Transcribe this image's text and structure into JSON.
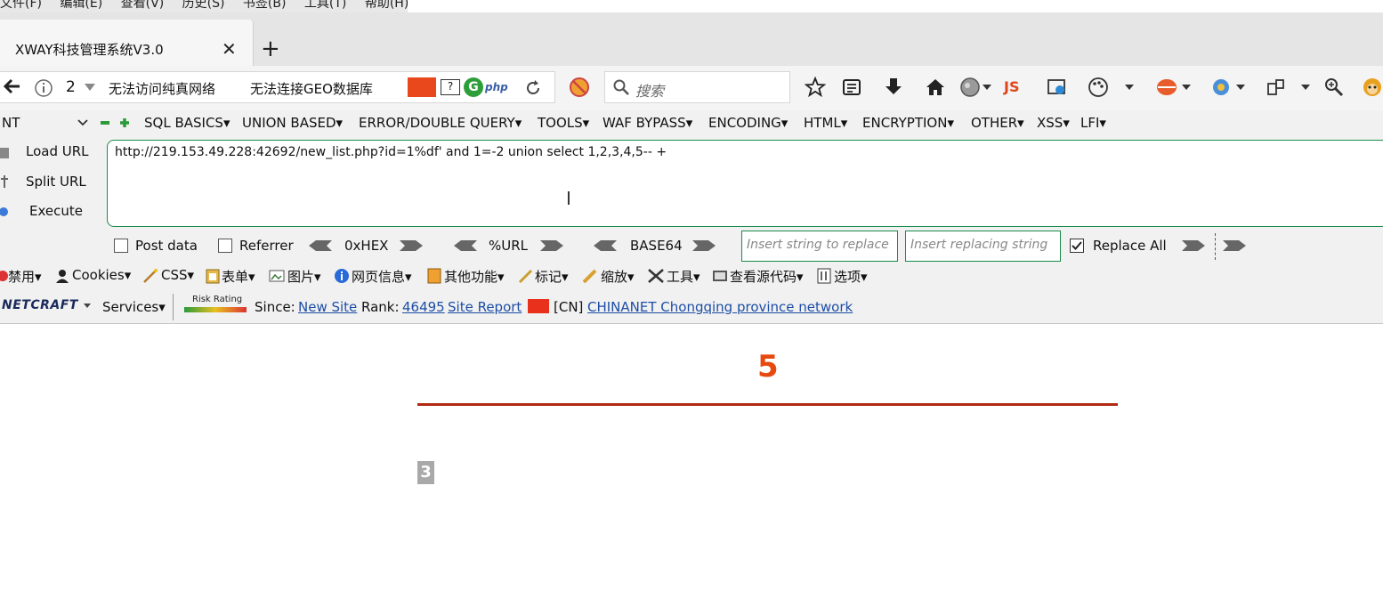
{
  "menubar": [
    "文件(F)",
    "编辑(E)",
    "查看(V)",
    "历史(S)",
    "书签(B)",
    "工具(T)",
    "帮助(H)"
  ],
  "tab": {
    "title": "XWAY科技管理系统V3.0",
    "close": "✕",
    "new": "+"
  },
  "nav": {
    "count": "2",
    "proxy1": "无法访问纯真网络",
    "proxy2": "无法连接GEO数据库",
    "search_placeholder": "搜索",
    "js": "JS"
  },
  "hackbar": {
    "select": "NT",
    "menus": [
      "SQL BASICS▾",
      "UNION BASED▾",
      "ERROR/DOUBLE QUERY▾",
      "TOOLS▾",
      "WAF BYPASS▾",
      "ENCODING▾",
      "HTML▾",
      "ENCRYPTION▾",
      "OTHER▾",
      "XSS▾",
      "LFI▾"
    ],
    "load_url": "Load URL",
    "split_url": "Split URL",
    "execute": "Execute",
    "url": "http://219.153.49.228:42692/new_list.php?id=1%df' and 1=-2 union select 1,2,3,4,5-- +",
    "post_data": "Post data",
    "referrer": "Referrer",
    "hex": "0xHEX",
    "urlenc": "%URL",
    "base64": "BASE64",
    "insert_placeholder": "Insert string to replace",
    "replacing_placeholder": "Insert replacing string",
    "replace_all": "Replace All"
  },
  "webdev": [
    "禁用▾",
    "Cookies▾",
    "CSS▾",
    "表单▾",
    "图片▾",
    "网页信息▾",
    "其他功能▾",
    "标记▾",
    "缩放▾",
    "工具▾",
    "查看源代码▾",
    "选项▾"
  ],
  "netcraft": {
    "logo": "NETCRAFT",
    "services": "Services▾",
    "risk": "Risk Rating",
    "since": "Since:",
    "new_site": "New Site",
    "rank": "Rank:",
    "rank_value": "46495",
    "site_report": "Site Report",
    "country": "[CN]",
    "network": "CHINANET Chongqing province network"
  },
  "content": {
    "big_number": "5",
    "value": "3"
  },
  "colors": {
    "accent_red": "#e74a0f",
    "rule": "#b02a12",
    "hackbar_border": "#1a8a4a"
  }
}
